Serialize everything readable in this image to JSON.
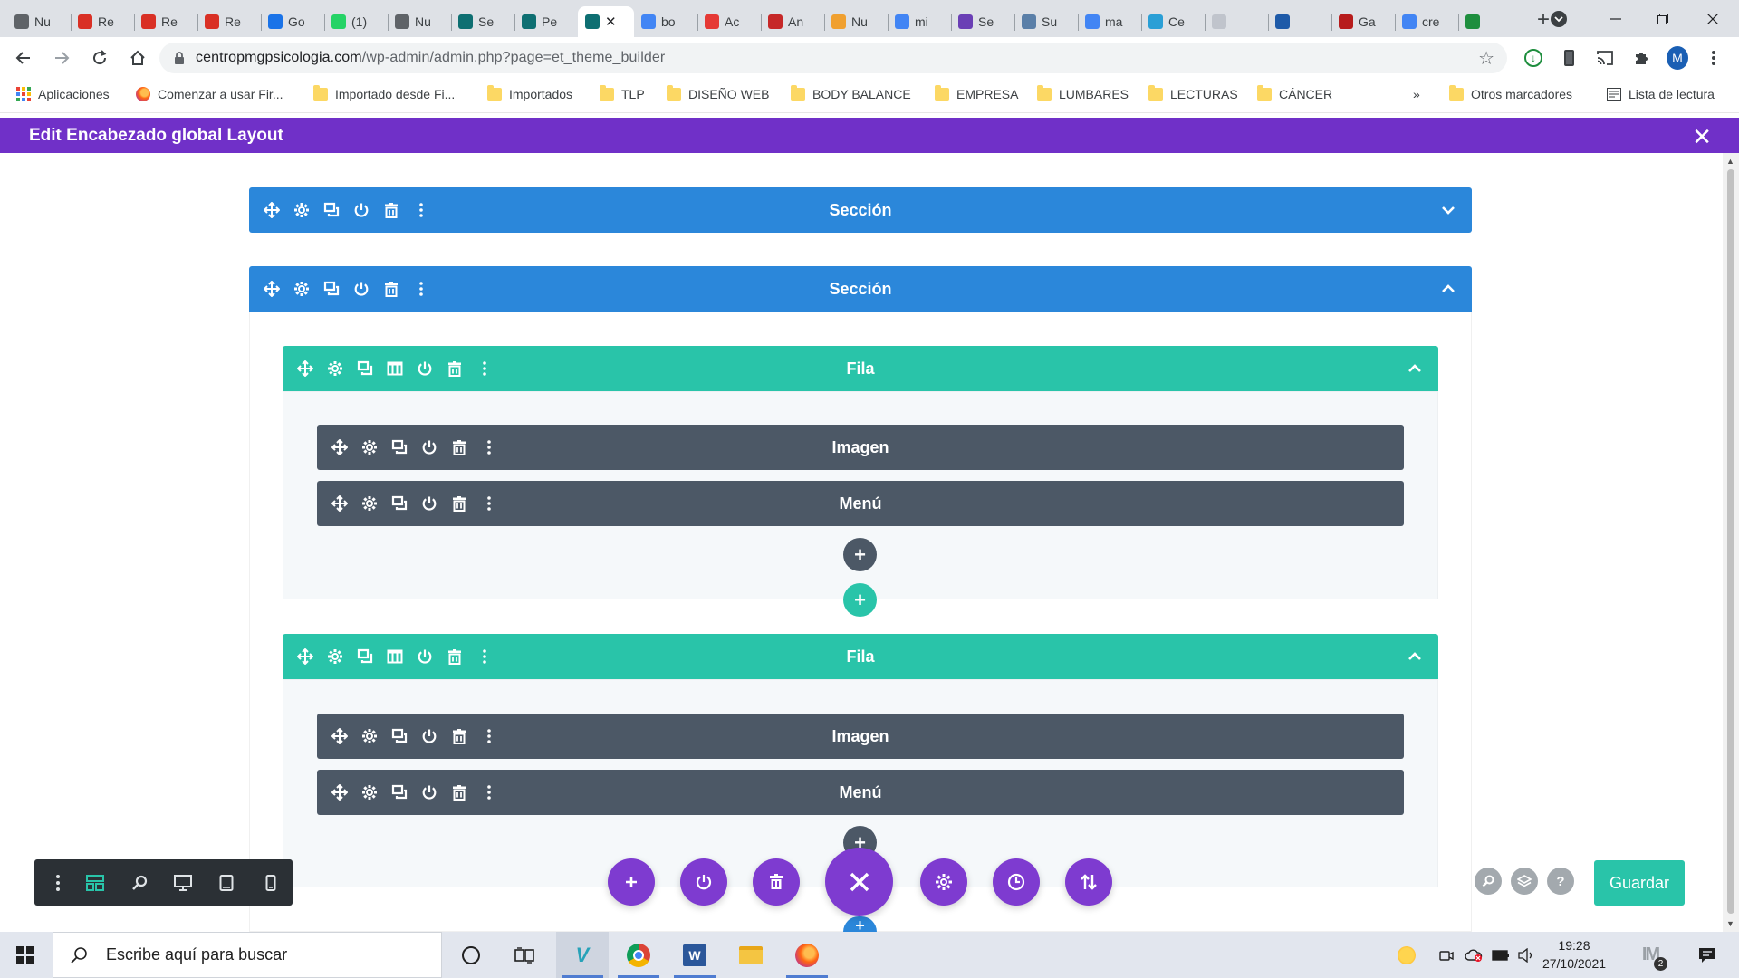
{
  "browser": {
    "tabs": [
      {
        "label": "Nu",
        "icon": "chrome-icon",
        "color": "#5f6368"
      },
      {
        "label": "Re",
        "icon": "gmail-icon",
        "color": "#d93025"
      },
      {
        "label": "Re",
        "icon": "gmail-icon",
        "color": "#d93025"
      },
      {
        "label": "Re",
        "icon": "gmail-icon",
        "color": "#d93025"
      },
      {
        "label": "Go",
        "icon": "calendar-icon",
        "color": "#1a73e8"
      },
      {
        "label": "(1)",
        "icon": "whatsapp-icon",
        "color": "#25d366"
      },
      {
        "label": "Nu",
        "icon": "chrome-icon",
        "color": "#5f6368"
      },
      {
        "label": "Se",
        "icon": "divi-icon",
        "color": "#0e6f72"
      },
      {
        "label": "Pe",
        "icon": "divi-icon",
        "color": "#0e6f72"
      },
      {
        "label": "",
        "icon": "divi-icon",
        "color": "#0e6f72",
        "active": true
      },
      {
        "label": "bo",
        "icon": "google-icon",
        "color": "#4285f4"
      },
      {
        "label": "Ac",
        "icon": "wuolah-icon",
        "color": "#e53935"
      },
      {
        "label": "An",
        "icon": "wuolah-icon",
        "color": "#c62828"
      },
      {
        "label": "Nu",
        "icon": "hand-icon",
        "color": "#f0a030"
      },
      {
        "label": "mi",
        "icon": "google-icon",
        "color": "#4285f4"
      },
      {
        "label": "Se",
        "icon": "feather-icon",
        "color": "#6a3fb5"
      },
      {
        "label": "Su",
        "icon": "link-icon",
        "color": "#5a7fa8"
      },
      {
        "label": "ma",
        "icon": "google-icon",
        "color": "#4285f4"
      },
      {
        "label": "Ce",
        "icon": "globe-icon",
        "color": "#2a9fd6"
      },
      {
        "label": "",
        "icon": "blank-icon",
        "color": "#c0c4cc"
      },
      {
        "label": "",
        "icon": "box-icon",
        "color": "#1e5aa8"
      },
      {
        "label": "Ga",
        "icon": "record-icon",
        "color": "#b71c1c"
      },
      {
        "label": "cre",
        "icon": "google-icon",
        "color": "#4285f4"
      },
      {
        "label": "",
        "icon": "sheet-icon",
        "color": "#1e8e3e"
      }
    ],
    "url_host": "centropmgpsicologia.com",
    "url_path": "/wp-admin/admin.php?page=et_theme_builder",
    "profile_initial": "M",
    "bookmarks": [
      {
        "label": "Aplicaciones",
        "type": "apps"
      },
      {
        "label": "Comenzar a usar Fir...",
        "type": "firefox"
      },
      {
        "label": "Importado desde Fi...",
        "type": "folder"
      },
      {
        "label": "Importados",
        "type": "folder"
      },
      {
        "label": "TLP",
        "type": "folder"
      },
      {
        "label": "DISEÑO WEB",
        "type": "folder"
      },
      {
        "label": "BODY BALANCE",
        "type": "folder"
      },
      {
        "label": "EMPRESA",
        "type": "folder"
      },
      {
        "label": "LUMBARES",
        "type": "folder"
      },
      {
        "label": "LECTURAS",
        "type": "folder"
      },
      {
        "label": "CÁNCER",
        "type": "folder"
      }
    ],
    "bookmarks_overflow": "»",
    "other_bookmarks": "Otros marcadores",
    "reading_list": "Lista de lectura"
  },
  "divi": {
    "header_title": "Edit Encabezado global Layout",
    "section_label": "Sección",
    "row_label": "Fila",
    "image_module_label": "Imagen",
    "menu_module_label": "Menú",
    "save_label": "Guardar",
    "colors": {
      "purple": "#7030c8",
      "section_blue": "#2b87da",
      "row_green": "#29c4a9",
      "module_gray": "#4c5866"
    }
  },
  "taskbar": {
    "search_placeholder": "Escribe aquí para buscar",
    "time": "19:28",
    "date": "27/10/2021",
    "notification_count": "2"
  }
}
